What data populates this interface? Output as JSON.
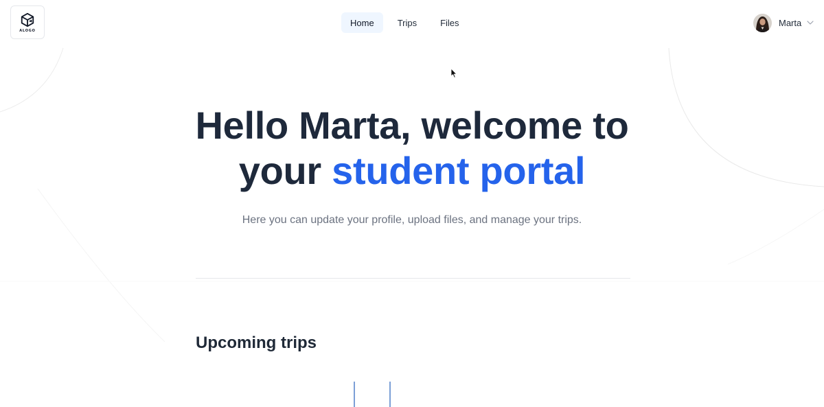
{
  "logo": {
    "text": "ALOGO"
  },
  "nav": {
    "items": [
      {
        "label": "Home",
        "active": true
      },
      {
        "label": "Trips",
        "active": false
      },
      {
        "label": "Files",
        "active": false
      }
    ]
  },
  "user": {
    "name": "Marta",
    "avatar": "avatar-photo",
    "menu_icon": "chevron-down-icon"
  },
  "hero": {
    "title_line1": "Hello Marta, welcome to",
    "title_line2_plain": "your",
    "title_line2_accent": "student portal",
    "subtitle": "Here you can update your profile, upload files, and manage your trips."
  },
  "sections": {
    "upcoming_title": "Upcoming trips"
  },
  "colors": {
    "accent": "#2563eb",
    "heading": "#1e293b",
    "muted": "#6b7280",
    "active_nav_bg": "#eff6ff"
  }
}
